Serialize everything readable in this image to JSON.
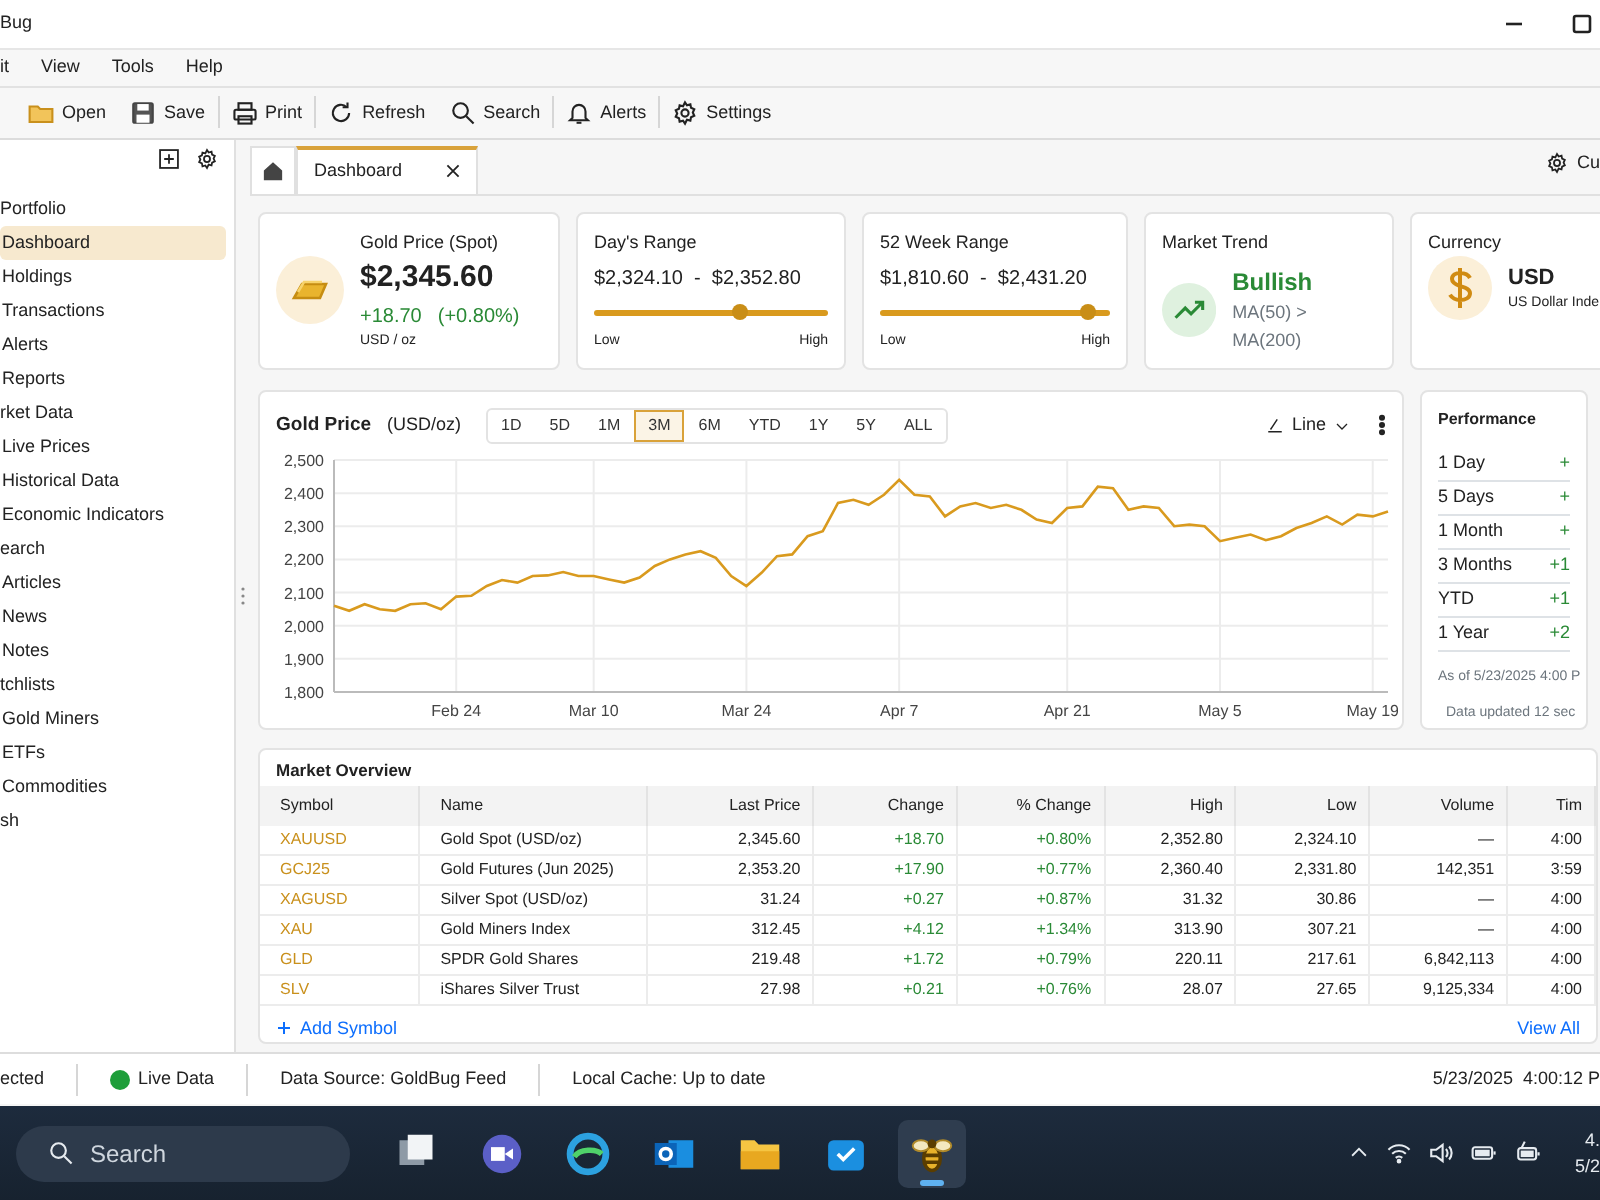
{
  "window": {
    "title": "Bug"
  },
  "menu": [
    "it",
    "View",
    "Tools",
    "Help"
  ],
  "toolbar": [
    {
      "label": "Open"
    },
    {
      "label": "Save"
    },
    {
      "label": "Print"
    },
    {
      "label": "Refresh"
    },
    {
      "label": "Search"
    },
    {
      "label": "Alerts"
    },
    {
      "label": "Settings"
    }
  ],
  "sidebar": {
    "groups": [
      {
        "label": "Portfolio",
        "children": [
          {
            "label": "Dashboard",
            "selected": true
          },
          {
            "label": "Holdings",
            "selected": false
          },
          {
            "label": "Transactions",
            "selected": false
          },
          {
            "label": "Alerts",
            "selected": false
          },
          {
            "label": "Reports",
            "selected": false
          }
        ]
      },
      {
        "label": "rket Data",
        "children": [
          {
            "label": "Live Prices",
            "selected": false
          },
          {
            "label": "Historical Data",
            "selected": false
          },
          {
            "label": "Economic Indicators",
            "selected": false
          }
        ]
      },
      {
        "label": "earch",
        "children": [
          {
            "label": "Articles",
            "selected": false
          },
          {
            "label": "News",
            "selected": false
          },
          {
            "label": "Notes",
            "selected": false
          }
        ]
      },
      {
        "label": "tchlists",
        "children": [
          {
            "label": "Gold Miners",
            "selected": false
          },
          {
            "label": "ETFs",
            "selected": false
          },
          {
            "label": "Commodities",
            "selected": false
          }
        ]
      },
      {
        "label": "sh"
      }
    ]
  },
  "tabs": [
    {
      "label": "Dashboard",
      "selected": true
    }
  ],
  "customize": "Cu",
  "stat_cards": [
    {
      "kind": "price",
      "title": "Gold Price (Spot)",
      "value": "$2,345.60",
      "change": "+18.70",
      "change_pct": "(+0.80%)",
      "unit": "USD / oz"
    },
    {
      "kind": "range",
      "title": "Day's Range",
      "value": "$2,324.10  -  $2,352.80",
      "level": 0.62,
      "low": "Low",
      "high": "High"
    },
    {
      "kind": "range",
      "title": "52 Week Range",
      "value": "$1,810.60  -  $2,431.20",
      "level": 0.9,
      "low": "Low",
      "high": "High"
    },
    {
      "kind": "trend",
      "title": "Market Trend",
      "value": "Bullish",
      "note": "MA(50) > MA(200)"
    },
    {
      "kind": "currency",
      "title": "Currency",
      "value": "USD",
      "note": "US Dollar Inde"
    }
  ],
  "chart_card": {
    "title": "Gold Price",
    "unit": "(USD/oz)",
    "ranges": [
      {
        "label": "1D",
        "selected": false
      },
      {
        "label": "5D",
        "selected": false
      },
      {
        "label": "1M",
        "selected": false
      },
      {
        "label": "3M",
        "selected": true
      },
      {
        "label": "6M",
        "selected": false
      },
      {
        "label": "YTD",
        "selected": false
      },
      {
        "label": "1Y",
        "selected": false
      },
      {
        "label": "5Y",
        "selected": false
      },
      {
        "label": "ALL",
        "selected": false
      }
    ],
    "chart_type": "Line",
    "chart_data": {
      "type": "line",
      "grid": true,
      "categories": [
        null,
        null,
        null,
        null,
        null,
        null,
        null,
        null,
        "Feb 24",
        null,
        null,
        null,
        null,
        null,
        null,
        null,
        null,
        "Mar 10",
        null,
        null,
        null,
        null,
        null,
        null,
        null,
        null,
        null,
        "Mar 24",
        null,
        null,
        null,
        null,
        null,
        null,
        null,
        null,
        null,
        "Apr 7",
        null,
        null,
        null,
        null,
        null,
        null,
        null,
        null,
        null,
        null,
        "Apr 21",
        null,
        null,
        null,
        null,
        null,
        null,
        null,
        null,
        null,
        "May 5",
        null,
        null,
        null,
        null,
        null,
        null,
        null,
        null,
        null,
        "May 19",
        null
      ],
      "ylim": [
        1800,
        2500
      ],
      "yticks": [
        {
          "value": 1800,
          "label": "1,800"
        },
        {
          "value": 1900,
          "label": "1,900"
        },
        {
          "value": 2000,
          "label": "2,000"
        },
        {
          "value": 2100,
          "label": "2,100"
        },
        {
          "value": 2200,
          "label": "2,200"
        },
        {
          "value": 2300,
          "label": "2,300"
        },
        {
          "value": 2400,
          "label": "2,400"
        },
        {
          "value": 2500,
          "label": "2,500"
        }
      ],
      "values": [
        2060,
        2045,
        2065,
        2050,
        2045,
        2065,
        2068,
        2050,
        2088,
        2090,
        2120,
        2138,
        2130,
        2150,
        2152,
        2162,
        2150,
        2150,
        2140,
        2130,
        2145,
        2180,
        2200,
        2215,
        2225,
        2205,
        2150,
        2120,
        2160,
        2210,
        2215,
        2270,
        2285,
        2370,
        2380,
        2365,
        2395,
        2440,
        2395,
        2390,
        2330,
        2360,
        2370,
        2355,
        2365,
        2350,
        2320,
        2310,
        2355,
        2360,
        2420,
        2415,
        2350,
        2360,
        2355,
        2300,
        2305,
        2300,
        2255,
        2265,
        2275,
        2258,
        2270,
        2295,
        2310,
        2330,
        2305,
        2335,
        2330,
        2345
      ]
    }
  },
  "performance": {
    "title": "Performance",
    "rows": [
      {
        "label": "1 Day",
        "value": "+"
      },
      {
        "label": "5 Days",
        "value": "+"
      },
      {
        "label": "1 Month",
        "value": "+"
      },
      {
        "label": "3 Months",
        "value": "+1"
      },
      {
        "label": "YTD",
        "value": "+1"
      },
      {
        "label": "1 Year",
        "value": "+2"
      }
    ],
    "as_of": "As of 5/23/2025 4:00 P",
    "updated": "Data updated 12 sec"
  },
  "market_overview": {
    "title": "Market Overview",
    "columns": [
      "Symbol",
      "Name",
      "Last Price",
      "Change",
      "% Change",
      "High",
      "Low",
      "Volume",
      "Tim"
    ],
    "rows": [
      [
        "XAUUSD",
        "Gold Spot (USD/oz)",
        "2,345.60",
        "+18.70",
        "+0.80%",
        "2,352.80",
        "2,324.10",
        "—",
        "4:00"
      ],
      [
        "GCJ25",
        "Gold Futures (Jun 2025)",
        "2,353.20",
        "+17.90",
        "+0.77%",
        "2,360.40",
        "2,331.80",
        "142,351",
        "3:59"
      ],
      [
        "XAGUSD",
        "Silver Spot (USD/oz)",
        "31.24",
        "+0.27",
        "+0.87%",
        "31.32",
        "30.86",
        "—",
        "4:00"
      ],
      [
        "XAU",
        "Gold Miners Index",
        "312.45",
        "+4.12",
        "+1.34%",
        "313.90",
        "307.21",
        "—",
        "4:00"
      ],
      [
        "GLD",
        "SPDR Gold Shares",
        "219.48",
        "+1.72",
        "+0.79%",
        "220.11",
        "217.61",
        "6,842,113",
        "4:00"
      ],
      [
        "SLV",
        "iShares Silver Trust",
        "27.98",
        "+0.21",
        "+0.76%",
        "28.07",
        "27.65",
        "9,125,334",
        "4:00"
      ]
    ],
    "add_symbol": "Add Symbol",
    "view_all": "View All"
  },
  "status_bar": {
    "connection": "ected",
    "live": {
      "label": "Live Data",
      "color": "#1e9e3a"
    },
    "source": "Data Source: GoldBug Feed",
    "cache": "Local Cache: Up to date",
    "datetime": "5/23/2025  4:00:12 P"
  },
  "taskbar": {
    "search": "Search",
    "apps": [
      {
        "selected": false
      },
      {
        "selected": false
      },
      {
        "selected": false
      },
      {
        "selected": false
      },
      {
        "selected": false
      },
      {
        "selected": false
      },
      {
        "selected": true
      }
    ],
    "clock_time": "4.",
    "clock_date": "5/2"
  }
}
